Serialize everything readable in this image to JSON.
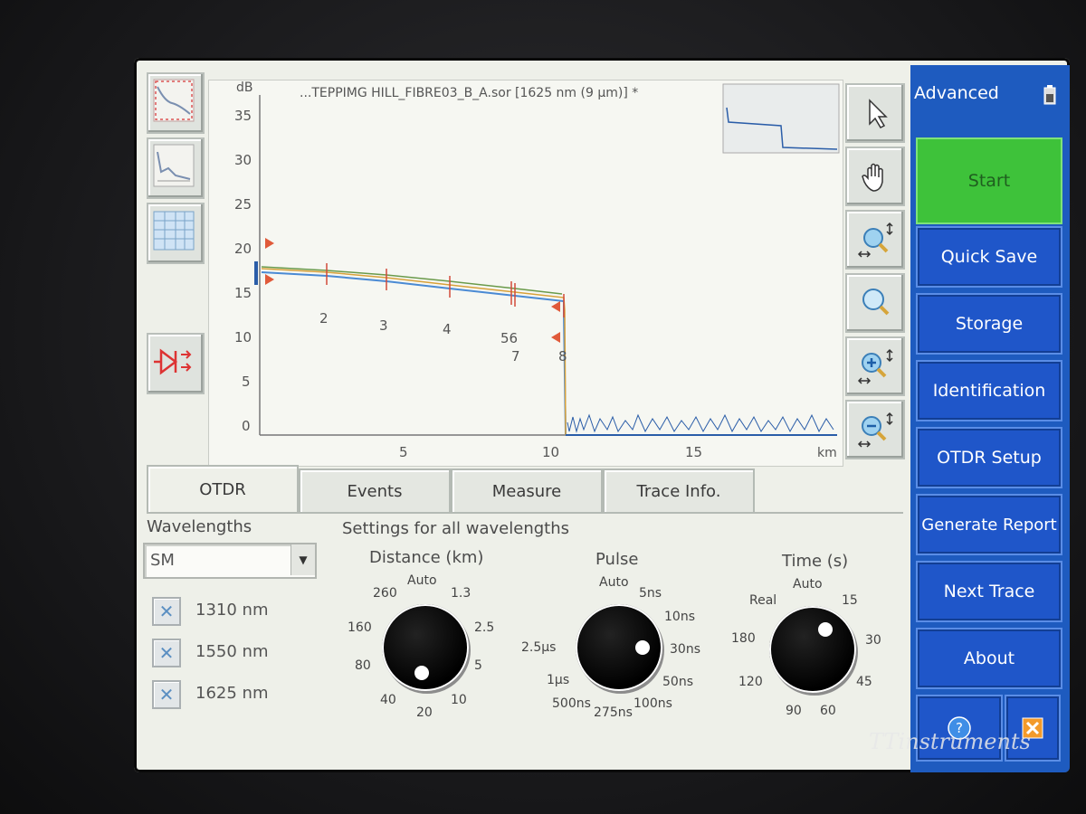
{
  "plot": {
    "title": "...TEPPIMG HILL_FIBRE03_B_A.sor [1625 nm (9 μm)] *",
    "y_unit": "dB",
    "x_unit": "km",
    "y_ticks": [
      "35",
      "30",
      "25",
      "20",
      "15",
      "10",
      "5",
      "0"
    ],
    "x_ticks": [
      "5",
      "10",
      "15"
    ],
    "event_labels": [
      "2",
      "3",
      "4",
      "56",
      "7",
      "8"
    ]
  },
  "tabs": [
    "OTDR",
    "Events",
    "Measure",
    "Trace Info."
  ],
  "wavelengths": {
    "label": "Wavelengths",
    "mode": "SM",
    "items": [
      "1310 nm",
      "1550 nm",
      "1625 nm"
    ]
  },
  "settings": {
    "header": "Settings for all wavelengths",
    "distance": {
      "label": "Distance (km)",
      "ticks": [
        "Auto",
        "1.3",
        "2.5",
        "5",
        "10",
        "20",
        "40",
        "80",
        "160",
        "260"
      ]
    },
    "pulse": {
      "label": "Pulse",
      "ticks": [
        "Auto",
        "5ns",
        "10ns",
        "30ns",
        "50ns",
        "100ns",
        "275ns",
        "500ns",
        "1μs",
        "2.5μs"
      ]
    },
    "time": {
      "label": "Time (s)",
      "ticks": [
        "Auto",
        "15",
        "30",
        "45",
        "60",
        "90",
        "120",
        "180",
        "Real"
      ]
    }
  },
  "sidebar": {
    "title": "Advanced",
    "buttons": [
      "Start",
      "Quick Save",
      "Storage",
      "Identification",
      "OTDR Setup",
      "Generate Report",
      "Next Trace",
      "About"
    ]
  },
  "watermark": "TTinstruments",
  "colors": {
    "sidebar": "#1e5bbf",
    "start": "#3ec23a",
    "marker": "#e05a3a"
  }
}
